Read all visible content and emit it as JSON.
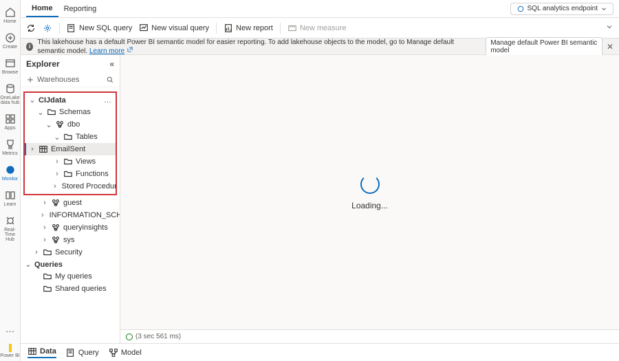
{
  "left_rail": {
    "home": "Home",
    "create": "Create",
    "browse": "Browse",
    "onelake": "OneLake data hub",
    "apps": "Apps",
    "metrics": "Metrics",
    "monitor": "Monitor",
    "learn": "Learn",
    "realtime": "Real-Time Hub",
    "powerbi": "Power BI"
  },
  "tabs": {
    "home": "Home",
    "reporting": "Reporting"
  },
  "endpoint": {
    "label": "SQL analytics endpoint"
  },
  "toolbar": {
    "new_sql_query": "New SQL query",
    "new_visual_query": "New visual query",
    "new_report": "New report",
    "new_measure": "New measure"
  },
  "info": {
    "text_a": "This lakehouse has a default Power BI semantic model for easier reporting. To add lakehouse objects to the model, go to Manage default semantic model.",
    "learn_more": "Learn more",
    "button": "Manage default Power BI semantic model"
  },
  "explorer": {
    "title": "Explorer",
    "warehouses": "Warehouses",
    "root": "CIJdata",
    "schemas": "Schemas",
    "dbo": "dbo",
    "tables": "Tables",
    "email_sent": "EmailSent",
    "views": "Views",
    "functions": "Functions",
    "sprocs": "Stored Procedur...",
    "guest": "guest",
    "info_schema": "INFORMATION_SCHE...",
    "queryinsights": "queryinsights",
    "sys": "sys",
    "security": "Security",
    "queries": "Queries",
    "my_queries": "My queries",
    "shared_queries": "Shared queries"
  },
  "canvas": {
    "loading": "Loading..."
  },
  "status": {
    "time": "(3 sec 561 ms)"
  },
  "bottom_tabs": {
    "data": "Data",
    "query": "Query",
    "model": "Model"
  }
}
